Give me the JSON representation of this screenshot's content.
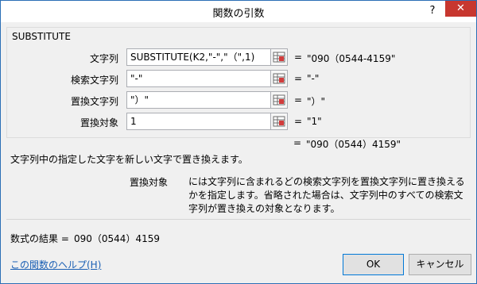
{
  "window": {
    "title": "関数の引数",
    "help_icon": "?",
    "close_icon": "✕"
  },
  "function": {
    "name": "SUBSTITUTE",
    "args": [
      {
        "label": "文字列",
        "value": "SUBSTITUTE(K2,\"-\",\"（\",1)",
        "result": "\"090（0544-4159\""
      },
      {
        "label": "検索文字列",
        "value": "\"-\"",
        "result": "\"-\""
      },
      {
        "label": "置換文字列",
        "value": "\"）\"",
        "result": "\"）\""
      },
      {
        "label": "置換対象",
        "value": "1",
        "result": "\"1\""
      }
    ],
    "equals": "=",
    "result": "\"090（0544）4159\""
  },
  "description": "文字列中の指定した文字を新しい文字で置き換えます。",
  "argument_help": {
    "name": "置換対象",
    "text": "には文字列に含まれるどの検索文字列を置換文字列に置き換えるかを指定します。省略された場合は、文字列中のすべての検索文字列が置き換えの対象となります。"
  },
  "formula_result": {
    "label": "数式の結果 =",
    "value": "090（0544）4159"
  },
  "footer": {
    "help_link": "この関数のヘルプ(H)",
    "ok": "OK",
    "cancel": "キャンセル"
  },
  "colors": {
    "close_button": "#c7372f",
    "link": "#1a5fb4",
    "dialog_bg": "#f0f0f0"
  }
}
